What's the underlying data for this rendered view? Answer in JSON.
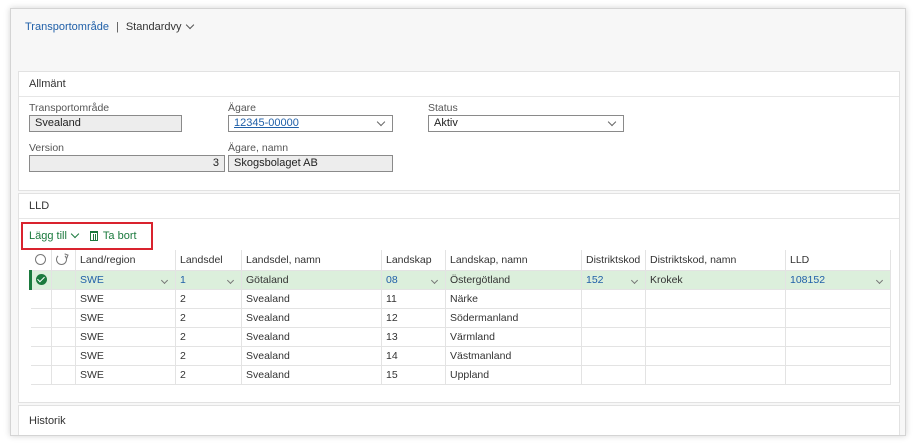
{
  "breadcrumb": {
    "area": "Transportområde",
    "separator": "|",
    "view": "Standardvy"
  },
  "general": {
    "title": "Allmänt",
    "fields": {
      "transport_area": {
        "label": "Transportområde",
        "value": "Svealand"
      },
      "owner": {
        "label": "Ägare",
        "value": "12345-00000"
      },
      "status": {
        "label": "Status",
        "value": "Aktiv"
      },
      "version": {
        "label": "Version",
        "value": "3"
      },
      "owner_name": {
        "label": "Ägare, namn",
        "value": "Skogsbolaget AB"
      }
    }
  },
  "lld": {
    "title": "LLD",
    "toolbar": {
      "add_label": "Lägg till",
      "delete_label": "Ta bort"
    },
    "columns": [
      "Land/region",
      "Landsdel",
      "Landsdel, namn",
      "Landskap",
      "Landskap, namn",
      "Distriktskod",
      "Distriktskod, namn",
      "LLD"
    ],
    "rows": [
      {
        "land": "SWE",
        "landsdel": "1",
        "landsdel_namn": "Götaland",
        "landskap": "08",
        "landskap_namn": "Östergötland",
        "distriktskod": "152",
        "distriktskod_namn": "Krokek",
        "lld": "108152",
        "selected": true
      },
      {
        "land": "SWE",
        "landsdel": "2",
        "landsdel_namn": "Svealand",
        "landskap": "11",
        "landskap_namn": "Närke",
        "distriktskod": "",
        "distriktskod_namn": "",
        "lld": ""
      },
      {
        "land": "SWE",
        "landsdel": "2",
        "landsdel_namn": "Svealand",
        "landskap": "12",
        "landskap_namn": "Södermanland",
        "distriktskod": "",
        "distriktskod_namn": "",
        "lld": ""
      },
      {
        "land": "SWE",
        "landsdel": "2",
        "landsdel_namn": "Svealand",
        "landskap": "13",
        "landskap_namn": "Värmland",
        "distriktskod": "",
        "distriktskod_namn": "",
        "lld": ""
      },
      {
        "land": "SWE",
        "landsdel": "2",
        "landsdel_namn": "Svealand",
        "landskap": "14",
        "landskap_namn": "Västmanland",
        "distriktskod": "",
        "distriktskod_namn": "",
        "lld": ""
      },
      {
        "land": "SWE",
        "landsdel": "2",
        "landsdel_namn": "Svealand",
        "landskap": "15",
        "landskap_namn": "Uppland",
        "distriktskod": "",
        "distriktskod_namn": "",
        "lld": ""
      }
    ]
  },
  "history": {
    "title": "Historik"
  },
  "colors": {
    "link": "#1f5fa8",
    "accent_green": "#1b7a3e",
    "selected_row": "#dcefdc",
    "highlight_border": "#d9232e"
  }
}
